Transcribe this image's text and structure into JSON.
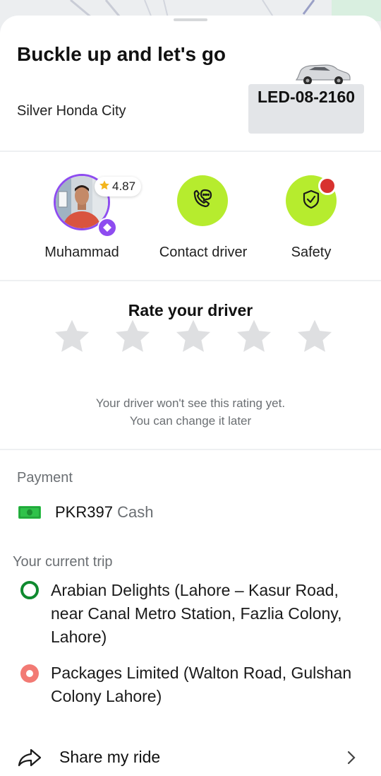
{
  "header": {
    "title": "Buckle up and let's go",
    "car_model": "Silver Honda City",
    "plate": "LED-08-2160"
  },
  "actions": {
    "driver_name": "Muhammad",
    "driver_rating": "4.87",
    "contact_label": "Contact driver",
    "safety_label": "Safety"
  },
  "rating": {
    "title": "Rate your driver",
    "stars_total": 5,
    "stars_selected": 0,
    "hint_line1": "Your driver won't see this rating yet.",
    "hint_line2": "You can change it later"
  },
  "payment": {
    "label": "Payment",
    "amount": "PKR397",
    "method": "Cash"
  },
  "trip": {
    "label": "Your current trip",
    "pickup": "Arabian Delights (Lahore – Kasur Road, near Canal Metro Station, Fazlia Colony, Lahore)",
    "dropoff": "Packages Limited (Walton Road, Gulshan Colony Lahore)"
  },
  "share": {
    "label": "Share my ride"
  },
  "colors": {
    "accent": "#b6ec2e",
    "pickup": "#0f8a2f",
    "dropoff": "#f27a74",
    "badge": "#8e4cf0",
    "alert": "#d8322f"
  }
}
